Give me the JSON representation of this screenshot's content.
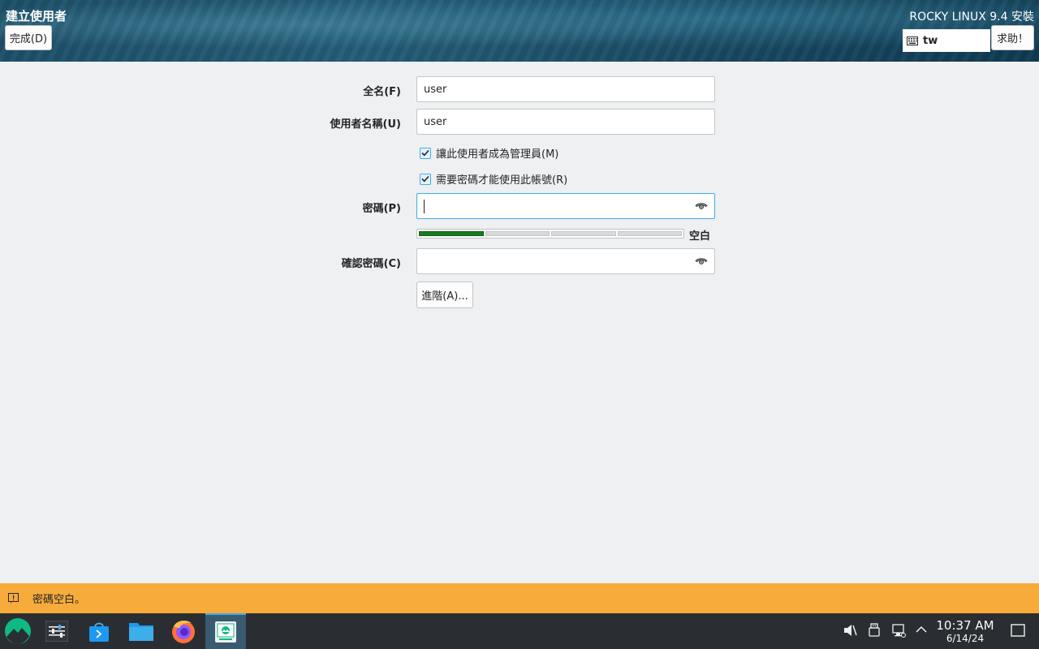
{
  "header": {
    "title": "建立使用者",
    "done_label": "完成(D)",
    "product": "ROCKY LINUX 9.4 安裝",
    "keyboard_layout": "tw",
    "help_label": "求助！"
  },
  "form": {
    "fullname_label": "全名(F)",
    "fullname_value": "user",
    "username_label": "使用者名稱(U)",
    "username_value": "user",
    "admin_checkbox_label": "讓此使用者成為管理員(M)",
    "admin_checked": true,
    "require_password_label": "需要密碼才能使用此帳號(R)",
    "require_password_checked": true,
    "password_label": "密碼(P)",
    "password_value": "",
    "strength_level": 1,
    "strength_segments": 4,
    "strength_text": "空白",
    "confirm_label": "確認密碼(C)",
    "confirm_value": "",
    "advanced_label": "進階(A)..."
  },
  "warning": {
    "message": "密碼空白。"
  },
  "taskbar": {
    "time": "10:37 AM",
    "date": "6/14/24"
  },
  "icons": [
    "keyboard-icon",
    "eye-icon",
    "checkmark-icon",
    "warning-icon",
    "rocky-logo-icon",
    "settings-icon",
    "store-icon",
    "folder-icon",
    "firefox-icon",
    "installer-icon",
    "volume-muted-icon",
    "usb-icon",
    "network-icon",
    "chevron-up-icon",
    "show-desktop-icon"
  ]
}
